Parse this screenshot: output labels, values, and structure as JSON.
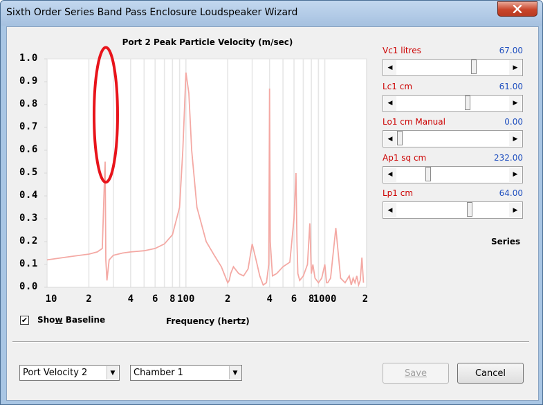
{
  "window": {
    "title": "Sixth Order Series Band Pass Enclosure Loudspeaker Wizard",
    "close_icon": "close-icon"
  },
  "chart_data": {
    "type": "line",
    "title": "Port 2 Peak Particle Velocity (m/sec)",
    "xlabel": "Frequency (hertz)",
    "ylabel": "",
    "x_scale": "log",
    "xlim": [
      10,
      2000
    ],
    "ylim": [
      0,
      1.0
    ],
    "y_ticks": [
      "1.0",
      "0.9",
      "0.8",
      "0.7",
      "0.6",
      "0.5",
      "0.4",
      "0.3",
      "0.2",
      "0.1",
      "0.0"
    ],
    "x_ticks": [
      "10",
      "2",
      "4",
      "6",
      "8",
      "100",
      "2",
      "4",
      "6",
      "8",
      "1000",
      "2"
    ],
    "grid": true,
    "series": [
      {
        "color": "#f4a9a4",
        "x": [
          10,
          15,
          20,
          23,
          25,
          26,
          26.2,
          26.5,
          27,
          28,
          30,
          35,
          40,
          50,
          60,
          70,
          80,
          90,
          95,
          100,
          105,
          110,
          120,
          140,
          160,
          180,
          200,
          205,
          210,
          220,
          240,
          260,
          280,
          300,
          320,
          340,
          360,
          380,
          395,
          400,
          405,
          420,
          450,
          500,
          560,
          600,
          620,
          630,
          640,
          660,
          700,
          750,
          780,
          800,
          820,
          850,
          900,
          950,
          1000,
          1030,
          1050,
          1100,
          1200,
          1300,
          1400,
          1500,
          1550,
          1600,
          1650,
          1700,
          1750,
          1800,
          1850,
          1900
        ],
        "y": [
          0.12,
          0.135,
          0.145,
          0.155,
          0.17,
          0.5,
          0.55,
          0.12,
          0.03,
          0.12,
          0.14,
          0.15,
          0.155,
          0.16,
          0.17,
          0.19,
          0.23,
          0.35,
          0.6,
          0.94,
          0.85,
          0.6,
          0.35,
          0.2,
          0.14,
          0.09,
          0.02,
          0.03,
          0.06,
          0.09,
          0.06,
          0.05,
          0.08,
          0.19,
          0.12,
          0.05,
          0.01,
          0.02,
          0.1,
          0.87,
          0.2,
          0.05,
          0.06,
          0.09,
          0.11,
          0.3,
          0.5,
          0.2,
          0.06,
          0.03,
          0.05,
          0.1,
          0.28,
          0.06,
          0.1,
          0.04,
          0.02,
          0.04,
          0.1,
          0.02,
          0.02,
          0.04,
          0.26,
          0.04,
          0.02,
          0.05,
          0.01,
          0.04,
          0.02,
          0.05,
          0.01,
          0.03,
          0.13,
          0.02
        ]
      }
    ],
    "annotation": {
      "shape": "ellipse",
      "color": "#e8141b",
      "around_x": 26.5,
      "around_y_range": [
        0.46,
        1.05
      ]
    }
  },
  "show_baseline": {
    "prefix": "Sho",
    "underlined": "w",
    "suffix": " Baseline",
    "checked": true,
    "check_glyph": "✔"
  },
  "params": [
    {
      "label": "Vc1  litres",
      "value": "67.00",
      "thumb_fraction": 0.7
    },
    {
      "label": "Lc1  cm",
      "value": "61.00",
      "thumb_fraction": 0.64
    },
    {
      "label": "Lo1  cm  Manual",
      "value": "0.00",
      "thumb_fraction": 0.0
    },
    {
      "label": "Ap1  sq cm",
      "value": "232.00",
      "thumb_fraction": 0.27
    },
    {
      "label": "Lp1  cm",
      "value": "64.00",
      "thumb_fraction": 0.66
    }
  ],
  "series_label": "Series",
  "bottom": {
    "combo_velocity": "Port Velocity 2",
    "combo_chamber": "Chamber 1",
    "save_label": "Save",
    "cancel_label": "Cancel",
    "dropdown_glyph": "▼"
  },
  "arrows": {
    "left": "◀",
    "right": "▶"
  },
  "colors": {
    "curve": "#f4a9a4",
    "annotation": "#e8141b",
    "param_label": "#cc0000",
    "param_value": "#1f4fbf"
  }
}
